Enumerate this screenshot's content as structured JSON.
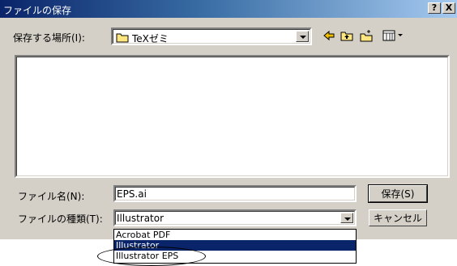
{
  "window": {
    "title": "ファイルの保存",
    "help_label": "?",
    "close_label": "X"
  },
  "location": {
    "label": "保存する場所(I):",
    "folder": "TeXゼミ"
  },
  "toolbar": {
    "back_icon": "back-arrow-icon",
    "up_icon": "up-folder-icon",
    "new_folder_icon": "new-folder-icon",
    "view_menu_icon": "view-menu-icon"
  },
  "filename": {
    "label": "ファイル名(N):",
    "value": "EPS.ai"
  },
  "filetype": {
    "label": "ファイルの種類(T):",
    "value": "Illustrator",
    "options": [
      "Acrobat PDF",
      "Illustrator",
      "Illustrator EPS"
    ],
    "selected_index": 1
  },
  "buttons": {
    "save": "保存(S)",
    "cancel": "キャンセル"
  },
  "colors": {
    "titlebar": "#0a246a",
    "face": "#d4d0c8",
    "selection": "#0a246a"
  }
}
